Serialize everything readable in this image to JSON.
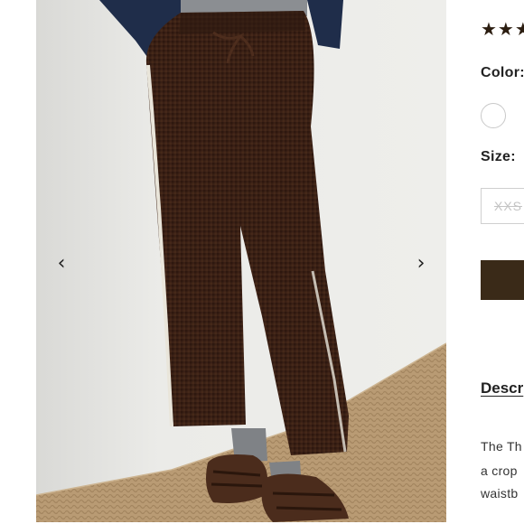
{
  "gallery": {
    "prev_arrow": "‹",
    "next_arrow": "›"
  },
  "product": {
    "stars_display": "★★★",
    "color_label": "Color:",
    "color_options": [
      {
        "name": "white",
        "hex": "#ffffff"
      }
    ],
    "size_label": "Size:",
    "size_options": [
      {
        "label": "XXS",
        "available": false
      }
    ],
    "add_button_color": "#3a2a18",
    "description_title": "Descr",
    "description_lines": [
      "The Th",
      "a crop",
      "waistb"
    ]
  },
  "colors": {
    "pants": "#3b2116",
    "wall": "#e8e7e3",
    "floor": "#b79a73",
    "cardigan": "#1f2d4a"
  }
}
